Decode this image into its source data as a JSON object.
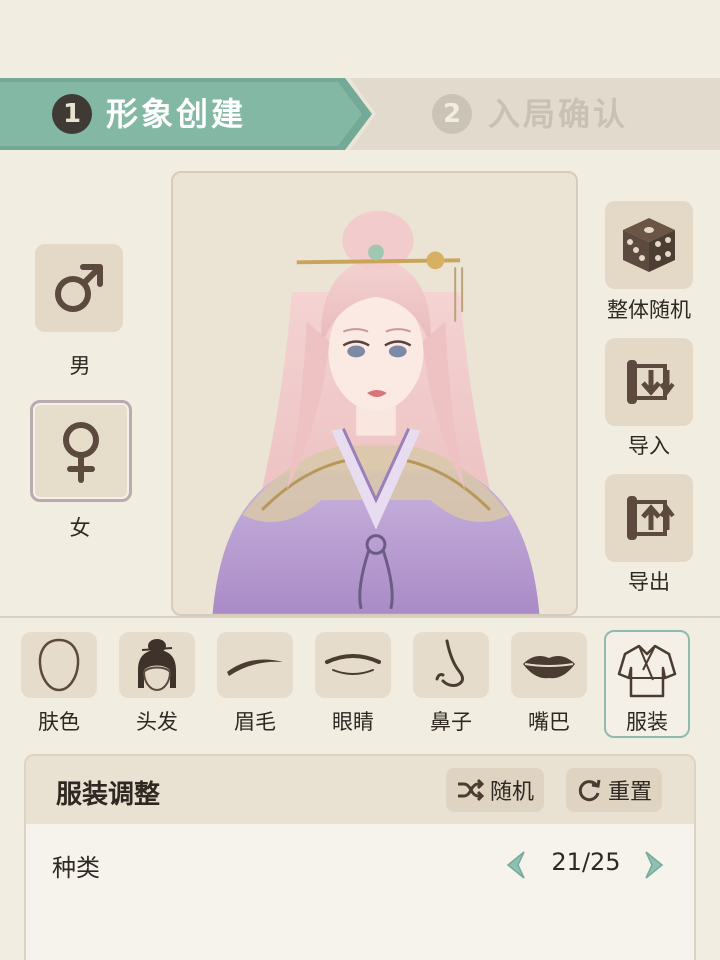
{
  "steps": [
    {
      "number": "1",
      "label": "形象创建",
      "active": true
    },
    {
      "number": "2",
      "label": "入局确认",
      "active": false
    }
  ],
  "gender": {
    "male_label": "男",
    "female_label": "女",
    "selected": "female"
  },
  "actions": {
    "random_all": "整体随机",
    "import": "导入",
    "export": "导出"
  },
  "feature_tabs": [
    {
      "label": "肤色",
      "icon": "face-outline-icon"
    },
    {
      "label": "头发",
      "icon": "hair-bun-icon"
    },
    {
      "label": "眉毛",
      "icon": "eyebrow-icon"
    },
    {
      "label": "眼睛",
      "icon": "eye-icon"
    },
    {
      "label": "鼻子",
      "icon": "nose-icon"
    },
    {
      "label": "嘴巴",
      "icon": "lips-icon"
    },
    {
      "label": "服装",
      "icon": "robe-icon",
      "selected": true
    }
  ],
  "adjust_panel": {
    "title": "服装调整",
    "random_label": "随机",
    "reset_label": "重置",
    "rows": [
      {
        "label": "种类",
        "value": "21/25"
      }
    ]
  },
  "colors": {
    "background": "#f1ede0",
    "accent_green": "#83b8a4",
    "button_beige": "#e4d9c7",
    "icon_brown": "#5b4a3d"
  }
}
